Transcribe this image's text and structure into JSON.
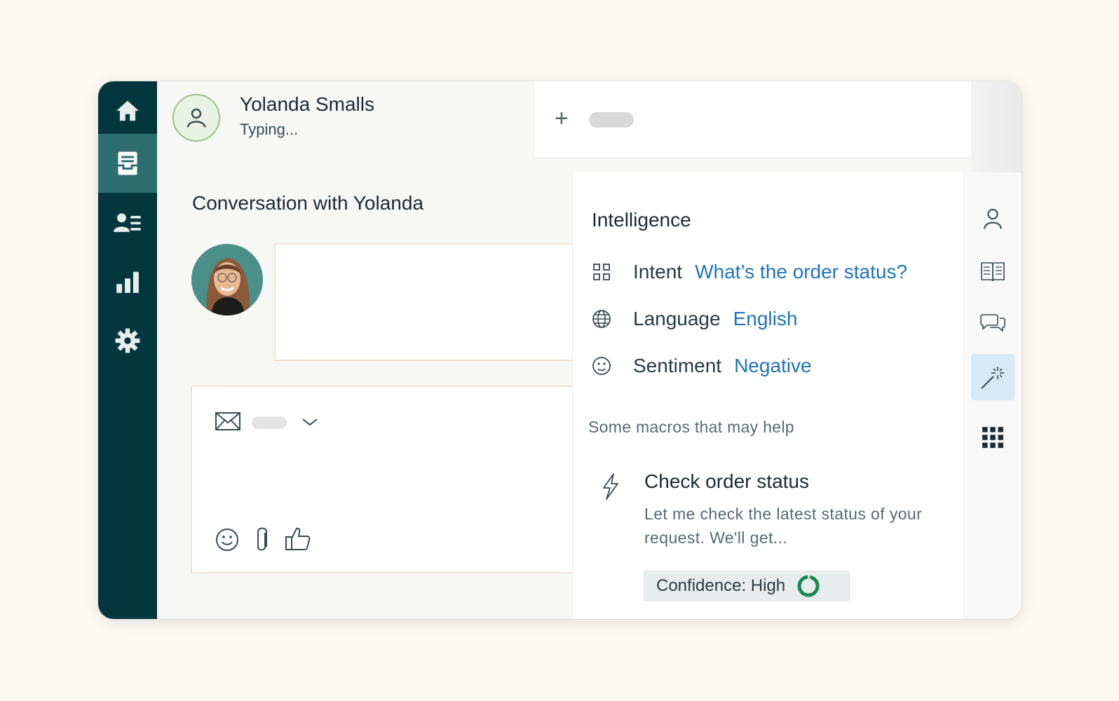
{
  "nav": {
    "items": [
      {
        "icon": "home-icon",
        "active": false
      },
      {
        "icon": "inbox-icon",
        "active": true
      },
      {
        "icon": "contacts-icon",
        "active": false
      },
      {
        "icon": "reports-icon",
        "active": false
      },
      {
        "icon": "settings-icon",
        "active": false
      }
    ]
  },
  "header": {
    "contact_name": "Yolanda Smalls",
    "contact_status": "Typing..."
  },
  "tabs": {
    "add_icon": "plus-icon"
  },
  "conversation": {
    "title": "Conversation with Yolanda"
  },
  "composer": {
    "channel_icon": "envelope-icon",
    "tools": [
      "emoji-icon",
      "attachment-icon",
      "thumbs-up-icon"
    ]
  },
  "intelligence": {
    "title": "Intelligence",
    "rows": [
      {
        "icon": "grid-icon",
        "label": "Intent",
        "value": "What’s the order status?"
      },
      {
        "icon": "globe-icon",
        "label": "Language",
        "value": "English"
      },
      {
        "icon": "face-icon",
        "label": "Sentiment",
        "value": "Negative"
      }
    ],
    "macros_heading": "Some macros that may help",
    "macro": {
      "icon": "lightning-icon",
      "title": "Check order status",
      "description": "Let me check the latest status of your request. We'll get...",
      "confidence_label": "Confidence: High"
    }
  },
  "rail": {
    "items": [
      {
        "icon": "user-icon",
        "active": false
      },
      {
        "icon": "book-icon",
        "active": false
      },
      {
        "icon": "chat-icon",
        "active": false
      },
      {
        "icon": "magic-wand-icon",
        "active": true
      },
      {
        "icon": "apps-grid-icon",
        "active": false
      }
    ]
  },
  "colors": {
    "nav_bg": "#03363d",
    "nav_active": "#2f6e70",
    "link_blue": "#1f73b7",
    "confidence_ring": "#1a8754",
    "rail_active": "#d6e9f5"
  }
}
